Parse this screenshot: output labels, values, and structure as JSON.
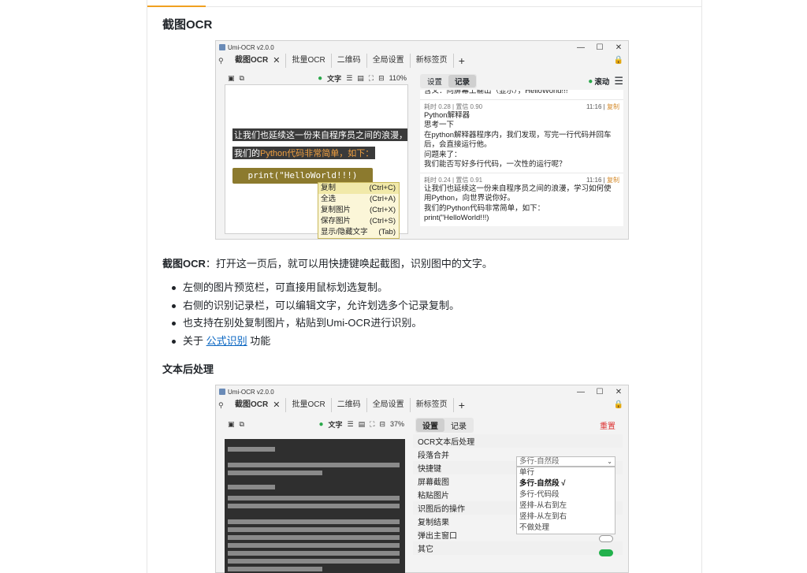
{
  "sections": {
    "ocr_heading": "截图OCR",
    "ocr_desc_bold": "截图OCR",
    "ocr_desc_rest": "：打开这一页后，就可以用快捷键唤起截图，识别图中的文字。",
    "bullets": [
      "左侧的图片预览栏，可直接用鼠标划选复制。",
      "右侧的识别记录栏，可以编辑文字，允许划选多个记录复制。",
      "也支持在别处复制图片，粘贴到Umi-OCR进行识别。"
    ],
    "bullet4_prefix": "关于",
    "bullet4_link": "公式识别",
    "bullet4_suffix": "功能",
    "post_heading": "文本后处理"
  },
  "win1": {
    "title": "Umi-OCR v2.0.0",
    "tabs": [
      "截图OCR",
      "批量OCR",
      "二维码",
      "全局设置",
      "新标签页"
    ],
    "close_glyph": "✕",
    "plus_glyph": "+",
    "toolbar": {
      "text_label": "文字",
      "zoom": "110%"
    },
    "preview_lines": [
      "让我们也延续这一份来自程序员之间的浪漫，",
      "我们的",
      "Python代码非常简单，如下：",
      "print(\"HelloWorld!!!)"
    ],
    "context_menu": [
      {
        "label": "复制",
        "key": "(Ctrl+C)"
      },
      {
        "label": "全选",
        "key": "(Ctrl+A)"
      },
      {
        "label": "复制图片",
        "key": "(Ctrl+X)"
      },
      {
        "label": "保存图片",
        "key": "(Ctrl+S)"
      },
      {
        "label": "显示/隐藏文字",
        "key": "(Tab)"
      }
    ],
    "panel_tabs": [
      "设置",
      "记录"
    ],
    "scroll_label": "滚动",
    "records": [
      {
        "meta_left": "",
        "meta_time": "",
        "lines": [
          "含义：向屏幕上输出（显示），HelloWorld!!!"
        ]
      },
      {
        "meta_left": "耗时 0.28 | 置信 0.90",
        "meta_time": "11:16 |",
        "copy": "复制",
        "lines": [
          "Python解释器",
          "思考一下",
          "在python解释器程序内，我们发现，写完一行代码并回车",
          "后，会直接运行他。",
          "问题来了：",
          "我们能否写好多行代码，一次性的运行呢？"
        ]
      },
      {
        "meta_left": "耗时 0.24 | 置信 0.91",
        "meta_time": "11:16 |",
        "copy": "复制",
        "lines": [
          "让我们也延续这一份来自程序员之间的浪漫，学习如何使",
          "用Python，向世界说你好。",
          "我们的Python代码非常简单，如下：",
          "print(\"HelloWorld!!!)"
        ]
      }
    ]
  },
  "win2": {
    "title": "Umi-OCR v2.0.0",
    "tabs": [
      "截图OCR",
      "批量OCR",
      "二维码",
      "全局设置",
      "新标签页"
    ],
    "toolbar": {
      "text_label": "文字",
      "zoom": "37%"
    },
    "panel_tabs": [
      "设置",
      "记录"
    ],
    "reset": "重置",
    "rows": [
      {
        "label": "OCR文本后处理",
        "group": true
      },
      {
        "label": "段落合并",
        "group": false
      },
      {
        "label": "快捷键",
        "group": true
      },
      {
        "label": "屏幕截图",
        "group": false
      },
      {
        "label": "粘贴图片",
        "group": false
      },
      {
        "label": "识图后的操作",
        "group": true
      },
      {
        "label": "复制结果",
        "group": false
      },
      {
        "label": "弹出主窗口",
        "group": false
      },
      {
        "label": "其它",
        "group": true
      }
    ],
    "dropdown_value": "多行-自然段",
    "dropdown_options": [
      "单行",
      "多行-自然段 √",
      "多行-代码段",
      "竖排-从右到左",
      "竖排-从左到右",
      "不做处理"
    ],
    "toggle_states": {
      "copy_result": false,
      "popup_window": true
    },
    "colors": {
      "toggle_on": "#22b14c",
      "reset": "#dd3333"
    }
  }
}
